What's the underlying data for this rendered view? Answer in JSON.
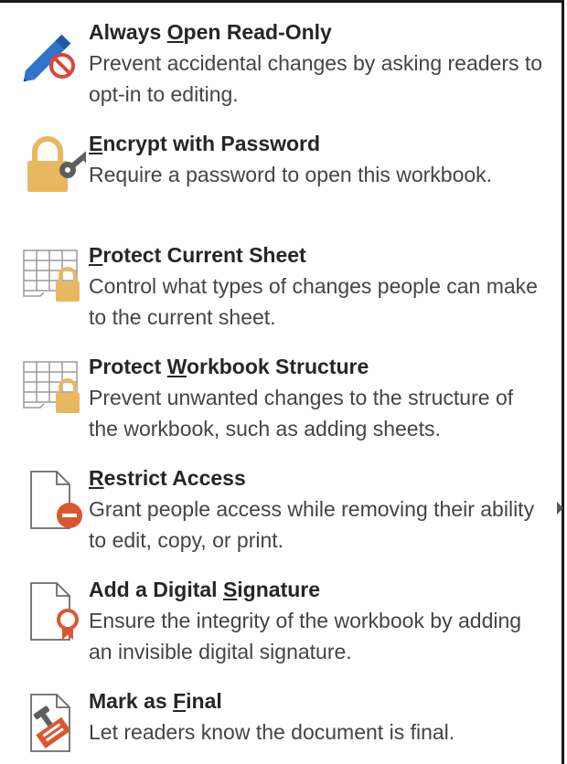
{
  "menu": {
    "items": [
      {
        "title_pre": "Always ",
        "title_key": "O",
        "title_post": "pen Read-Only",
        "description": "Prevent accidental changes by asking readers to opt-in to editing.",
        "icon": "pencil-no-edit-icon"
      },
      {
        "title_pre": "",
        "title_key": "E",
        "title_post": "ncrypt with Password",
        "description": "Require a password to open this workbook.",
        "icon": "lock-key-icon"
      },
      {
        "title_pre": "",
        "title_key": "P",
        "title_post": "rotect Current Sheet",
        "description": "Control what types of changes people can make to the current sheet.",
        "icon": "sheet-lock-icon"
      },
      {
        "title_pre": "Protect ",
        "title_key": "W",
        "title_post": "orkbook Structure",
        "description": "Prevent unwanted changes to the structure of the workbook, such as adding sheets.",
        "icon": "workbook-lock-icon"
      },
      {
        "title_pre": "",
        "title_key": "R",
        "title_post": "estrict Access",
        "description": "Grant people access while removing their ability to edit, copy, or print.",
        "icon": "document-restrict-icon"
      },
      {
        "title_pre": "Add a Digital ",
        "title_key": "S",
        "title_post": "ignature",
        "description": "Ensure the integrity of the workbook by adding an invisible digital signature.",
        "icon": "document-ribbon-icon"
      },
      {
        "title_pre": "Mark as ",
        "title_key": "F",
        "title_post": "inal",
        "description": "Let readers know the document is final.",
        "icon": "stamp-icon"
      }
    ]
  }
}
